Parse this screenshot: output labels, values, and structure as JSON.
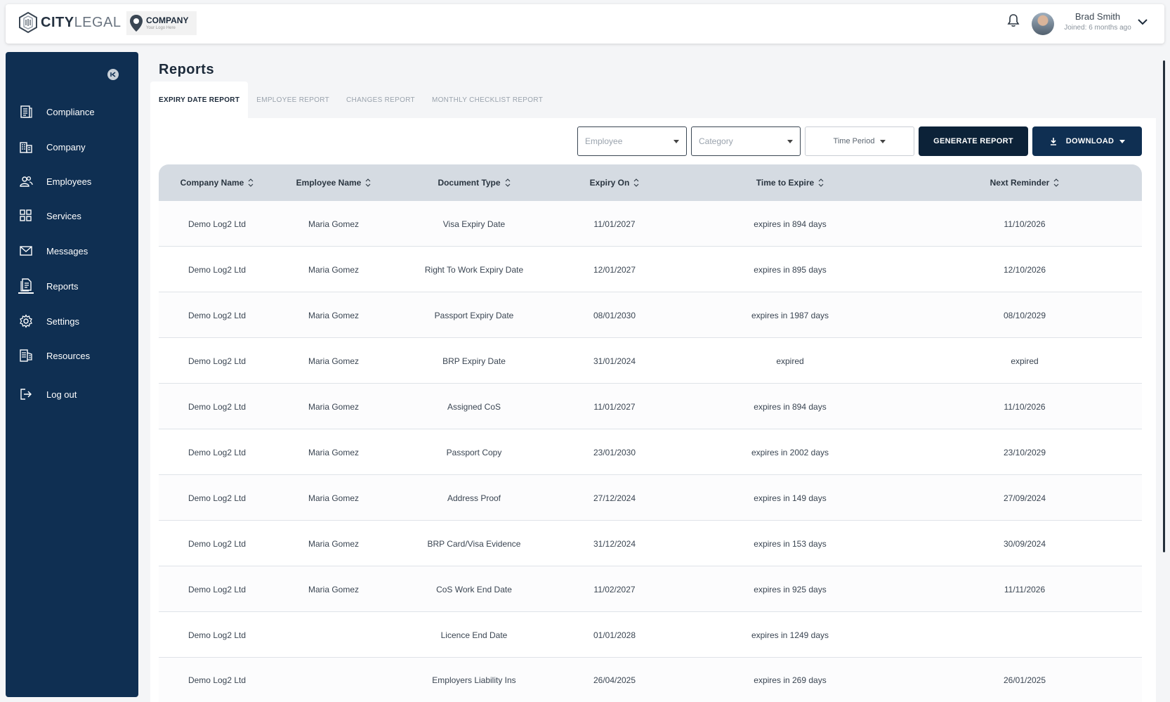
{
  "header": {
    "brand_bold": "CITY",
    "brand_light": "LEGAL",
    "company_name": "COMPANY",
    "company_tagline": "Your Logo Here",
    "user_name": "Brad Smith",
    "user_joined": "Joined: 6 months ago"
  },
  "sidebar": {
    "items": [
      {
        "label": "Compliance",
        "icon": "compliance-icon"
      },
      {
        "label": "Company",
        "icon": "building-icon"
      },
      {
        "label": "Employees",
        "icon": "users-icon"
      },
      {
        "label": "Services",
        "icon": "grid-icon"
      },
      {
        "label": "Messages",
        "icon": "mail-icon"
      },
      {
        "label": "Reports",
        "icon": "report-icon"
      },
      {
        "label": "Settings",
        "icon": "gear-icon"
      },
      {
        "label": "Resources",
        "icon": "resources-icon"
      },
      {
        "label": "Log out",
        "icon": "logout-icon"
      }
    ],
    "active": "Reports"
  },
  "page": {
    "title": "Reports",
    "tabs": [
      "EXPIRY DATE REPORT",
      "EMPLOYEE REPORT",
      "CHANGES REPORT",
      "MONTHLY CHECKLIST REPORT"
    ],
    "active_tab": "EXPIRY DATE REPORT"
  },
  "filters": {
    "employee_placeholder": "Employee",
    "category_placeholder": "Category",
    "time_period": "Time Period",
    "generate": "GENERATE REPORT",
    "download": "DOWNLOAD"
  },
  "table": {
    "columns": [
      "Company Name",
      "Employee Name",
      "Document Type",
      "Expiry On",
      "Time to Expire",
      "Next Reminder"
    ],
    "rows": [
      [
        "Demo Log2 Ltd",
        "Maria Gomez",
        "Visa Expiry Date",
        "11/01/2027",
        "expires in 894 days",
        "11/10/2026"
      ],
      [
        "Demo Log2 Ltd",
        "Maria Gomez",
        "Right To Work Expiry Date",
        "12/01/2027",
        "expires in 895 days",
        "12/10/2026"
      ],
      [
        "Demo Log2 Ltd",
        "Maria Gomez",
        "Passport Expiry Date",
        "08/01/2030",
        "expires in 1987 days",
        "08/10/2029"
      ],
      [
        "Demo Log2 Ltd",
        "Maria Gomez",
        "BRP Expiry Date",
        "31/01/2024",
        "expired",
        "expired"
      ],
      [
        "Demo Log2 Ltd",
        "Maria Gomez",
        "Assigned CoS",
        "11/01/2027",
        "expires in 894 days",
        "11/10/2026"
      ],
      [
        "Demo Log2 Ltd",
        "Maria Gomez",
        "Passport Copy",
        "23/01/2030",
        "expires in 2002 days",
        "23/10/2029"
      ],
      [
        "Demo Log2 Ltd",
        "Maria Gomez",
        "Address Proof",
        "27/12/2024",
        "expires in 149 days",
        "27/09/2024"
      ],
      [
        "Demo Log2 Ltd",
        "Maria Gomez",
        "BRP Card/Visa Evidence",
        "31/12/2024",
        "expires in 153 days",
        "30/09/2024"
      ],
      [
        "Demo Log2 Ltd",
        "Maria Gomez",
        "CoS Work End Date",
        "11/02/2027",
        "expires in 925 days",
        "11/11/2026"
      ],
      [
        "Demo Log2 Ltd",
        "",
        "Licence End Date",
        "01/01/2028",
        "expires in 1249 days",
        ""
      ],
      [
        "Demo Log2 Ltd",
        "",
        "Employers Liability Ins",
        "26/04/2025",
        "expires in 269 days",
        "26/01/2025"
      ]
    ]
  },
  "colors": {
    "sidebar": "#0f2f52",
    "accent": "#0c2238",
    "table_header": "#d5dbe2"
  }
}
